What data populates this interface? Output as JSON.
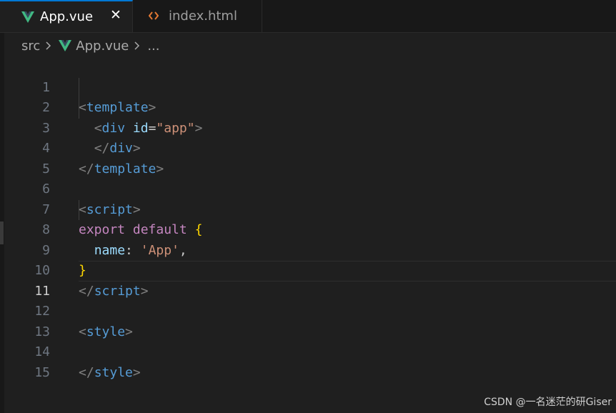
{
  "tabs": [
    {
      "label": "App.vue",
      "icon": "vue-icon",
      "active": true,
      "close": "✕"
    },
    {
      "label": "index.html",
      "icon": "html-icon",
      "active": false
    }
  ],
  "breadcrumb": {
    "folder": "src",
    "file": "App.vue",
    "more": "..."
  },
  "editor": {
    "current_line": 11,
    "lines": [
      {
        "num": "1"
      },
      {
        "num": "2"
      },
      {
        "num": "3"
      },
      {
        "num": "4"
      },
      {
        "num": "5"
      },
      {
        "num": "6"
      },
      {
        "num": "7"
      },
      {
        "num": "8"
      },
      {
        "num": "9"
      },
      {
        "num": "10"
      },
      {
        "num": "11"
      },
      {
        "num": "12"
      },
      {
        "num": "13"
      },
      {
        "num": "14"
      },
      {
        "num": "15"
      }
    ],
    "code": {
      "l1": {
        "open": "<",
        "tag": "template",
        "close": ">"
      },
      "l2": {
        "indent": "  ",
        "open": "<",
        "tag": "div",
        "attr": "id",
        "eq": "=",
        "value": "\"app\"",
        "close": ">"
      },
      "l3": {
        "indent": "  ",
        "open": "</",
        "tag": "div",
        "close": ">"
      },
      "l4": {
        "open": "</",
        "tag": "template",
        "close": ">"
      },
      "l6": {
        "open": "<",
        "tag": "script",
        "close": ">"
      },
      "l7": {
        "kw1": "export",
        "kw2": "default",
        "brace": "{"
      },
      "l8": {
        "indent": "  ",
        "prop": "name",
        "colon": ":",
        "value": "'App'",
        "comma": ","
      },
      "l9": {
        "brace": "}"
      },
      "l10": {
        "open": "</",
        "tag": "script",
        "close": ">"
      },
      "l12": {
        "open": "<",
        "tag": "style",
        "close": ">"
      },
      "l14": {
        "open": "</",
        "tag": "style",
        "close": ">"
      }
    }
  },
  "watermark": "CSDN @一名迷茫的研Giser",
  "colors": {
    "vue_green": "#41b883",
    "html_orange": "#e37933",
    "active_tab_border": "#0078d4"
  }
}
